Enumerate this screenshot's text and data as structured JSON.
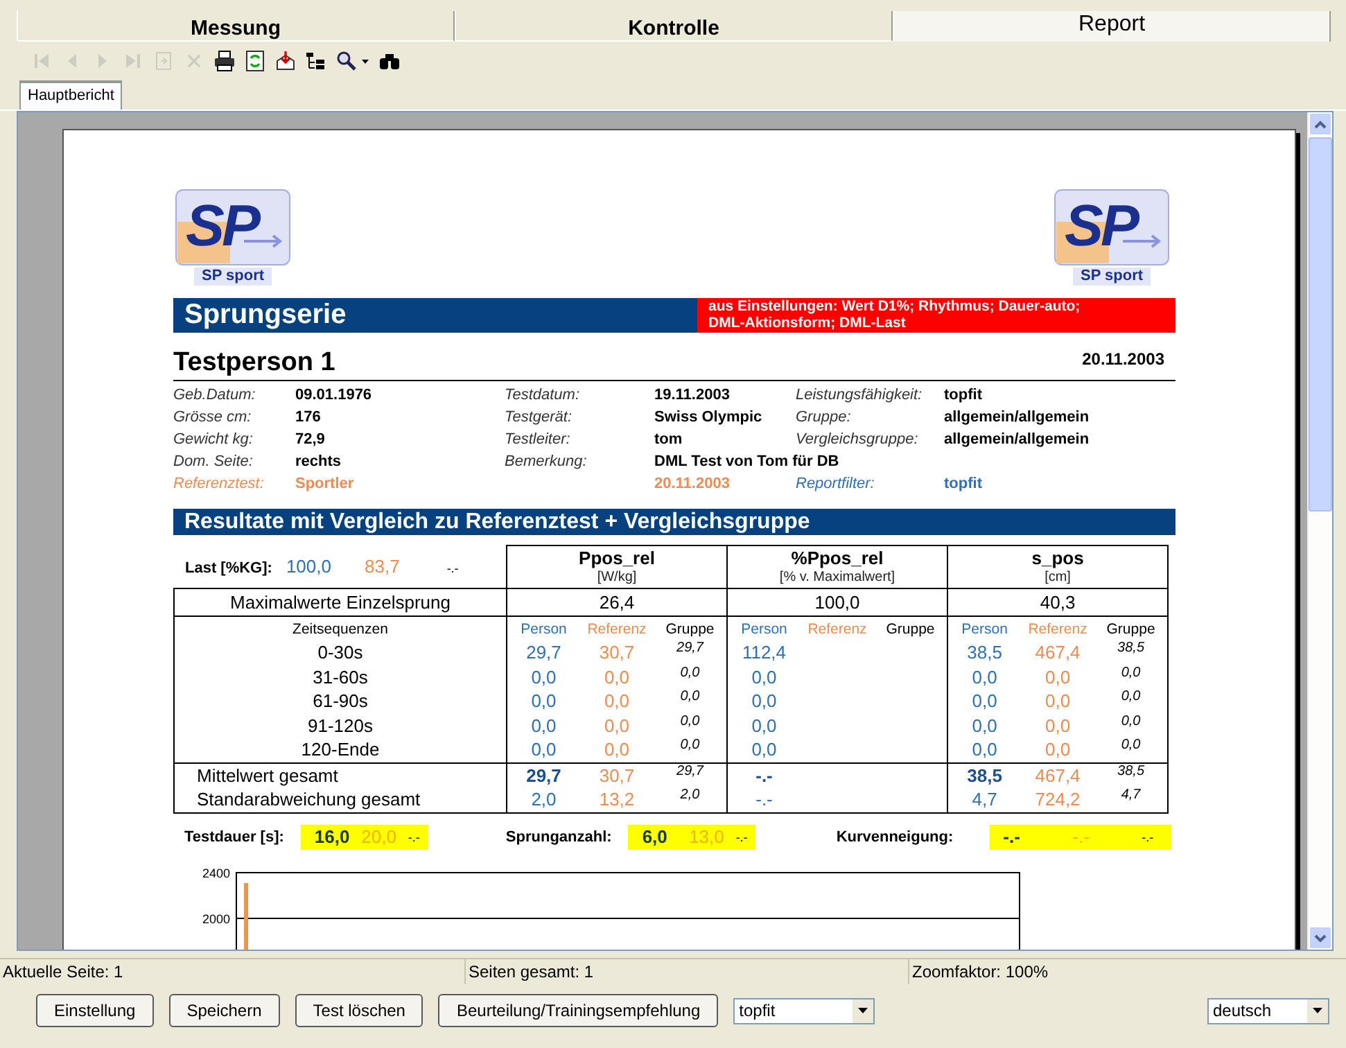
{
  "tabs": [
    {
      "label": "Messung",
      "selected": false
    },
    {
      "label": "Kontrolle",
      "selected": false
    },
    {
      "label": "Report",
      "selected": true
    }
  ],
  "toolbar": [
    {
      "kind": "first",
      "disabled": true
    },
    {
      "kind": "prev",
      "disabled": true
    },
    {
      "kind": "next",
      "disabled": true
    },
    {
      "kind": "last",
      "disabled": true
    },
    {
      "kind": "page",
      "disabled": true
    },
    {
      "kind": "close",
      "disabled": true
    },
    {
      "kind": "print",
      "disabled": false
    },
    {
      "kind": "refresh",
      "disabled": false
    },
    {
      "kind": "export",
      "disabled": false
    },
    {
      "kind": "tree",
      "disabled": false
    },
    {
      "kind": "zoom",
      "disabled": false
    },
    {
      "kind": "caret",
      "disabled": false
    },
    {
      "kind": "find",
      "disabled": false
    }
  ],
  "report_tabs": [
    {
      "label": "Hauptbericht",
      "selected": true
    }
  ],
  "report": {
    "logos": [
      {
        "mark": "SP",
        "caption": "SP sport"
      },
      {
        "mark": "SP",
        "caption": "SP sport"
      }
    ],
    "title": "Sprungserie",
    "note": "aus Einstellungen: Wert D1%; Rhythmus; Dauer-auto; DML-Aktionsform; DML-Last",
    "person": "Testperson 1",
    "date": "20.11.2003",
    "info_rows": [
      [
        {
          "label": "Geb.Datum:",
          "value": "09.01.1976",
          "kind": "normal"
        },
        {
          "label": "Testdatum:",
          "value": "19.11.2003",
          "kind": "normal"
        },
        {
          "label": "Leistungsfähigkeit:",
          "value": "topfit",
          "kind": "normal"
        }
      ],
      [
        {
          "label": "Grösse cm:",
          "value": "176",
          "kind": "normal"
        },
        {
          "label": "Testgerät:",
          "value": "Swiss Olympic",
          "kind": "normal"
        },
        {
          "label": "Gruppe:",
          "value": "allgemein/allgemein",
          "kind": "normal"
        }
      ],
      [
        {
          "label": "Gewicht kg:",
          "value": "72,9",
          "kind": "normal"
        },
        {
          "label": "Testleiter:",
          "value": "tom",
          "kind": "normal"
        },
        {
          "label": "Vergleichsgruppe:",
          "value": "allgemein/allgemein",
          "kind": "normal"
        }
      ],
      [
        {
          "label": "Dom. Seite:",
          "value": "rechts",
          "kind": "normal"
        },
        {
          "label": "Bemerkung:",
          "value": "DML Test von Tom für DB",
          "kind": "normal"
        },
        null
      ],
      [
        {
          "label": "Referenztest:",
          "value": "Sportler",
          "kind": "reference"
        },
        {
          "value": "20.11.2003",
          "kind": "reference"
        },
        {
          "label": "Reportfilter:",
          "value": "topfit",
          "kind": "filter"
        }
      ]
    ],
    "section_title": "Resultate mit Vergleich zu Referenztest + Vergleichsgruppe",
    "load": {
      "label": "Last [%KG]:",
      "person": "100,0",
      "reference": "83,7",
      "group": "-.-"
    },
    "max_label": "Maximalwerte Einzelsprung",
    "sequence_label": "Zeitsequenzen",
    "metrics": [
      {
        "name": "Ppos_rel",
        "unit": "[W/kg]",
        "max": "26,4",
        "subheaders": [
          "Person",
          "Referenz",
          "Gruppe"
        ]
      },
      {
        "name": "%Ppos_rel",
        "unit": "[% v. Maximalwert]",
        "max": "100,0",
        "subheaders": [
          "Person",
          "Referenz",
          "Gruppe"
        ]
      },
      {
        "name": "s_pos",
        "unit": "[cm]",
        "max": "40,3",
        "subheaders": [
          "Person",
          "Referenz",
          "Gruppe"
        ]
      }
    ],
    "rows": [
      {
        "label": "0-30s",
        "kind": "sequence",
        "emphasis": false,
        "values": [
          [
            "29,7",
            "30,7",
            "29,7"
          ],
          [
            "112,4"
          ],
          [
            "38,5",
            "467,4",
            "38,5"
          ]
        ]
      },
      {
        "label": "31-60s",
        "kind": "sequence",
        "emphasis": false,
        "values": [
          [
            "0,0",
            "0,0",
            "0,0"
          ],
          [
            "0,0"
          ],
          [
            "0,0",
            "0,0",
            "0,0"
          ]
        ]
      },
      {
        "label": "61-90s",
        "kind": "sequence",
        "emphasis": false,
        "values": [
          [
            "0,0",
            "0,0",
            "0,0"
          ],
          [
            "0,0"
          ],
          [
            "0,0",
            "0,0",
            "0,0"
          ]
        ]
      },
      {
        "label": "91-120s",
        "kind": "sequence",
        "emphasis": false,
        "values": [
          [
            "0,0",
            "0,0",
            "0,0"
          ],
          [
            "0,0"
          ],
          [
            "0,0",
            "0,0",
            "0,0"
          ]
        ]
      },
      {
        "label": "120-Ende",
        "kind": "sequence",
        "emphasis": false,
        "values": [
          [
            "0,0",
            "0,0",
            "0,0"
          ],
          [
            "0,0"
          ],
          [
            "0,0",
            "0,0",
            "0,0"
          ]
        ]
      },
      {
        "label": "Mittelwert gesamt",
        "kind": "summary",
        "emphasis": true,
        "values": [
          [
            "29,7",
            "30,7",
            "29,7"
          ],
          [
            "-.-"
          ],
          [
            "38,5",
            "467,4",
            "38,5"
          ]
        ]
      },
      {
        "label": "Standarabweichung gesamt",
        "kind": "summary",
        "emphasis": false,
        "values": [
          [
            "2,0",
            "13,2",
            "2,0"
          ],
          [
            "-.-"
          ],
          [
            "4,7",
            "724,2",
            "4,7"
          ]
        ]
      }
    ],
    "totals": [
      {
        "label": "Testdauer [s]:",
        "person": "16,0",
        "reference": "20,0",
        "group": "-.-"
      },
      {
        "label": "Sprunganzahl:",
        "person": "6,0",
        "reference": "13,0",
        "group": "-.-"
      },
      {
        "label": "Kurvenneigung:",
        "person": "-.-",
        "reference": "-.-",
        "group": "-.-"
      }
    ],
    "chart": {
      "y_tick_labels": [
        "2400",
        "2000"
      ]
    }
  },
  "status_bar": [
    "Aktuelle Seite: 1",
    "Seiten gesamt: 1",
    "Zoomfaktor: 100%"
  ],
  "buttons": [
    "Einstellung",
    "Speichern",
    "Test löschen",
    "Beurteilung/Trainingsempfehlung"
  ],
  "filter_select": {
    "value": "topfit"
  },
  "language_select": {
    "value": "deutsch"
  }
}
